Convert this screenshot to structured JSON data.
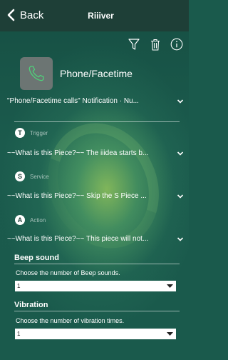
{
  "navbar": {
    "back_label": "Back",
    "title": "Riiiver"
  },
  "toolbar": {
    "icons": [
      "filter-icon",
      "trash-icon",
      "info-icon"
    ]
  },
  "header": {
    "title": "Phone/Facetime",
    "icon": "phone-icon"
  },
  "notification_row": {
    "text": "\"Phone/Facetime calls\" Notification  · Nu..."
  },
  "trigger": {
    "badge": "T",
    "label": "Trigger",
    "text": "~~What is this Piece?~~ The iiidea starts b..."
  },
  "service": {
    "badge": "S",
    "label": "Service",
    "text": "~~What is this Piece?~~ Skip the S Piece ..."
  },
  "action": {
    "badge": "A",
    "label": "Action",
    "text": "~~What is this Piece?~~ This piece will not..."
  },
  "beep": {
    "title": "Beep sound",
    "desc": "Choose the number of Beep sounds.",
    "value": "1"
  },
  "vibration": {
    "title": "Vibration",
    "desc": "Choose the number of vibration times.",
    "value": "1"
  },
  "colors": {
    "navbar": "#1e3f37",
    "background": "#1a5a4c",
    "accent": "#c8eb5a"
  }
}
